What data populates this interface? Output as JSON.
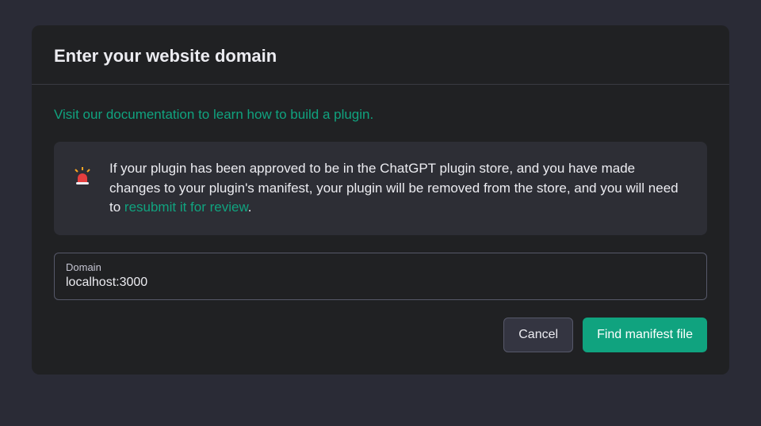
{
  "modal": {
    "title": "Enter your website domain",
    "docLink": "Visit our documentation to learn how to build a plugin.",
    "warning": {
      "textBefore": "If your plugin has been approved to be in the ChatGPT plugin store, and you have made changes to your plugin's manifest, your plugin will be removed from the store, and you will need to ",
      "linkText": "resubmit it for review",
      "textAfter": "."
    },
    "input": {
      "label": "Domain",
      "value": "localhost:3000"
    },
    "buttons": {
      "cancel": "Cancel",
      "submit": "Find manifest file"
    }
  }
}
